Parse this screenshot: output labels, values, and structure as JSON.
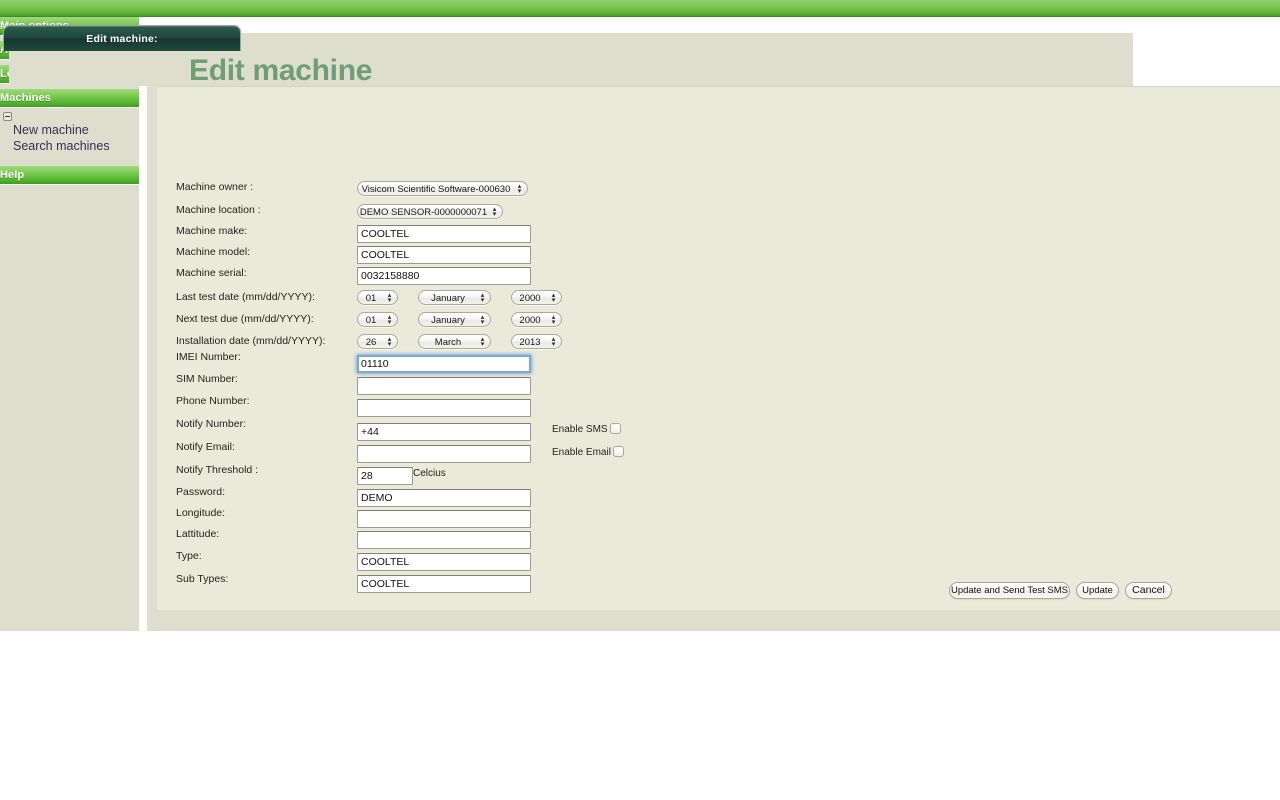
{
  "app": {
    "tab_label": "Edit machine:",
    "page_title": "Edit machine"
  },
  "sidebar": {
    "items": [
      {
        "label": "Main options"
      },
      {
        "label": "Accounts"
      },
      {
        "label": "Locations"
      },
      {
        "label": "Machines"
      },
      {
        "label": "Help"
      }
    ],
    "submenu": {
      "collapse_icon": "minus-box-icon",
      "links": [
        {
          "label": "New machine"
        },
        {
          "label": "Search machines"
        }
      ]
    }
  },
  "form": {
    "fields": {
      "machine_owner": {
        "label": "Machine owner :",
        "value": "Visicom Scientific Software-000630"
      },
      "machine_location": {
        "label": "Machine location :",
        "value": "DEMO SENSOR-0000000071"
      },
      "machine_make": {
        "label": "Machine make:",
        "value": "COOLTEL"
      },
      "machine_model": {
        "label": "Machine model:",
        "value": "COOLTEL"
      },
      "machine_serial": {
        "label": "Machine serial:",
        "value": "0032158880"
      },
      "last_test_date": {
        "label": "Last test date (mm/dd/YYYY):",
        "day": "01",
        "month": "January",
        "year": "2000"
      },
      "next_test_due": {
        "label": "Next test due (mm/dd/YYYY):",
        "day": "01",
        "month": "January",
        "year": "2000"
      },
      "installation_date": {
        "label": "Installation date (mm/dd/YYYY):",
        "day": "26",
        "month": "March",
        "year": "2013"
      },
      "imei_number": {
        "label": "IMEI Number:",
        "value": "01110"
      },
      "sim_number": {
        "label": "SIM Number:",
        "value": ""
      },
      "phone_number": {
        "label": "Phone Number:",
        "value": ""
      },
      "notify_number": {
        "label": "Notify Number:",
        "value": "+44"
      },
      "notify_email": {
        "label": "Notify Email:",
        "value": ""
      },
      "notify_threshold": {
        "label": "Notify Threshold :",
        "value": "28",
        "unit": "Celcius"
      },
      "password": {
        "label": "Password:",
        "value": "DEMO"
      },
      "longitude": {
        "label": "Longitude:",
        "value": ""
      },
      "lattitude": {
        "label": "Lattitude:",
        "value": ""
      },
      "type": {
        "label": "Type:",
        "value": "COOLTEL"
      },
      "sub_types": {
        "label": "Sub Types:",
        "value": "COOLTEL"
      }
    },
    "checkboxes": {
      "enable_sms": {
        "label": "Enable SMS",
        "checked": false
      },
      "enable_email": {
        "label": "Enable Email",
        "checked": false
      }
    },
    "buttons": {
      "update_and_send_test_sms": "Update and Send Test SMS",
      "update": "Update",
      "cancel": "Cancel"
    }
  },
  "colors": {
    "nav_green": "#59b832",
    "title_green": "#6f9e74",
    "panel_bg": "#eaeadb",
    "chrome_bg": "#dedece",
    "tab_dark": "#1e4539",
    "focus_blue": "#7aa9d8"
  }
}
